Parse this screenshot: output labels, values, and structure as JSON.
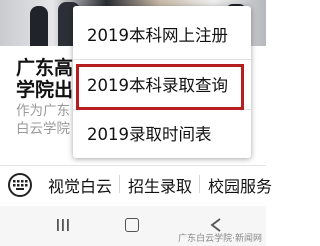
{
  "article": {
    "title": "广东高\n学院出",
    "description": "作为广东\n白云学院"
  },
  "popup_menu": {
    "items": [
      {
        "label": "2019本科网上注册"
      },
      {
        "label": "2019本科录取查询",
        "highlighted": true
      },
      {
        "label": "2019录取时间表"
      }
    ],
    "highlight_color": "#b51f1f"
  },
  "menu_bar": {
    "keyboard_icon": "keyboard-icon",
    "items": [
      {
        "label": "视觉白云"
      },
      {
        "label": "招生录取"
      },
      {
        "label": "校园服务"
      }
    ]
  },
  "nav_bar": {
    "icons": [
      "recent-apps-icon",
      "home-icon",
      "back-icon"
    ]
  },
  "watermark": "广东白云学院·新闻网"
}
